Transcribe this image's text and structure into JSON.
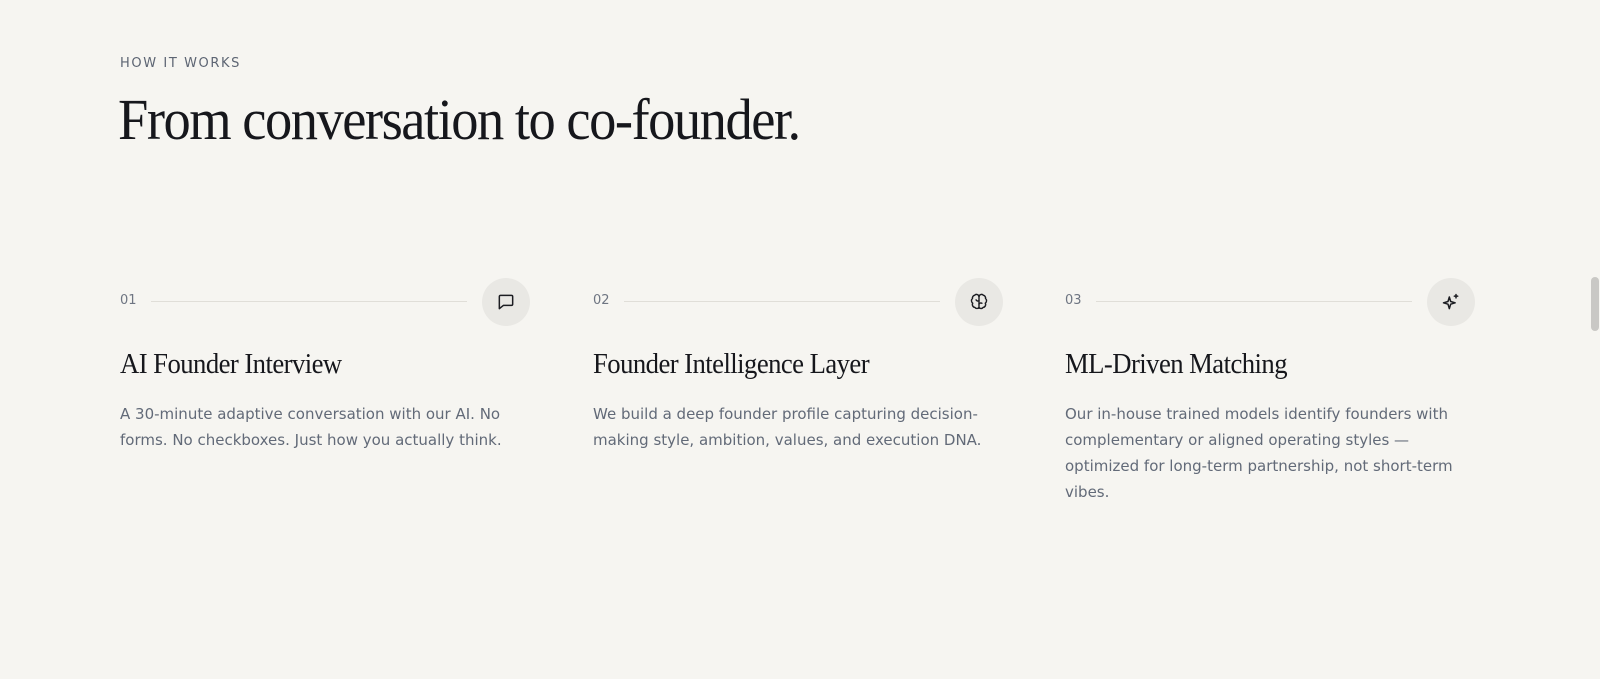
{
  "section": {
    "eyebrow": "HOW IT WORKS",
    "headline": "From conversation to co-founder."
  },
  "steps": [
    {
      "number": "01",
      "icon": "chat-bubble-icon",
      "title": "AI Founder Interview",
      "description": "A 30-minute adaptive conversation with our AI. No forms. No checkboxes. Just how you actually think."
    },
    {
      "number": "02",
      "icon": "brain-icon",
      "title": "Founder Intelligence Layer",
      "description": "We build a deep founder profile capturing decision-making style, ambition, values, and execution DNA."
    },
    {
      "number": "03",
      "icon": "sparkles-icon",
      "title": "ML-Driven Matching",
      "description": "Our in-house trained models identify founders with complementary or aligned operating styles — optimized for long-term partnership, not short-term vibes."
    }
  ],
  "colors": {
    "background": "#f6f5f1",
    "heading": "#16171c",
    "body_text": "#626a78",
    "icon_circle": "#e9e8e4"
  }
}
